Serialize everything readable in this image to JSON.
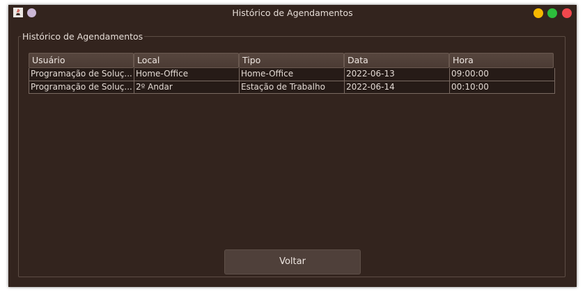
{
  "window": {
    "title": "Histórico de Agendamentos",
    "controls": {
      "minimize_color": "#f5b800",
      "maximize_color": "#2dbd3c",
      "close_color": "#f0474d"
    }
  },
  "panel": {
    "legend": "Histórico de Agendamentos"
  },
  "table": {
    "columns": [
      "Usuário",
      "Local",
      "Tipo",
      "Data",
      "Hora"
    ],
    "rows": [
      [
        "Programação de Soluç...",
        "Home-Office",
        "Home-Office",
        "2022-06-13",
        "09:00:00"
      ],
      [
        "Programação de Soluç...",
        "2º Andar",
        "Estação de Trabalho",
        "2022-06-14",
        "00:10:00"
      ]
    ]
  },
  "actions": {
    "back_label": "Voltar"
  }
}
